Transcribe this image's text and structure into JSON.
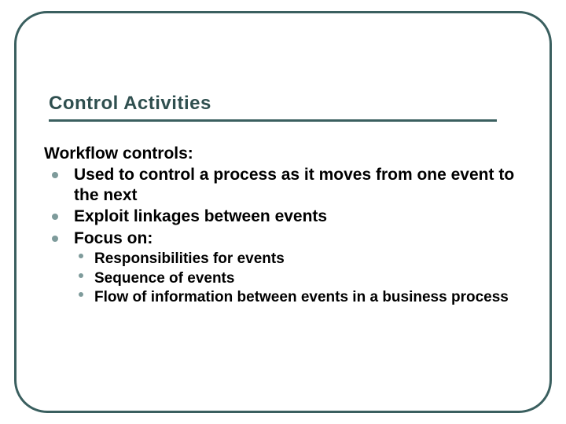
{
  "title": "Control Activities",
  "subheading": "Workflow controls:",
  "bullets": [
    {
      "text": "Used to control a process as it moves from one event to the next"
    },
    {
      "text": "Exploit linkages between events"
    },
    {
      "text": "Focus on:",
      "children": [
        {
          "text": "Responsibilities for events"
        },
        {
          "text": "Sequence of events"
        },
        {
          "text": "Flow of information between events in a business process"
        }
      ]
    }
  ],
  "colors": {
    "border": "#3a5f5f",
    "title": "#2f4f4f",
    "bullet": "#7e9b9b",
    "text": "#000000"
  }
}
